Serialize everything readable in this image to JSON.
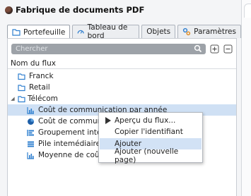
{
  "app": {
    "title": "Fabrique de documents PDF"
  },
  "tabs": [
    {
      "label": "Portefeuille",
      "active": true,
      "icon": "folder-icon"
    },
    {
      "label": "Tableau de bord",
      "active": false,
      "icon": "gauge-icon"
    },
    {
      "label": "Objets",
      "active": false,
      "icon": ""
    },
    {
      "label": "Paramètres",
      "active": false,
      "icon": "gears-icon"
    }
  ],
  "search": {
    "placeholder": "Chercher",
    "value": ""
  },
  "list": {
    "column_header": "Nom du flux",
    "items": [
      {
        "label": "Franck",
        "icon": "folder-icon",
        "indent": 1
      },
      {
        "label": "Retail",
        "icon": "folder-icon",
        "indent": 1
      },
      {
        "label": "Télécom",
        "icon": "folder-icon",
        "indent": 0,
        "expanded": true
      },
      {
        "label": "Coût de communication par année",
        "icon": "bar-chart-icon",
        "indent": 2,
        "selected": true
      },
      {
        "label": "Coût de communic",
        "icon": "pie-chart-icon",
        "indent": 2
      },
      {
        "label": "Groupement intelli",
        "icon": "grouping-icon",
        "indent": 2
      },
      {
        "label": "Pile intemédiaire",
        "icon": "stack-icon",
        "indent": 2
      },
      {
        "label": "Moyenne de coût a",
        "icon": "bar-chart-icon",
        "indent": 2
      }
    ]
  },
  "context_menu": {
    "items": [
      {
        "label": "Aperçu du flux...",
        "highlighted": false
      },
      {
        "label": "Copier l'identifiant",
        "highlighted": false
      },
      {
        "label": "Ajouter",
        "highlighted": true
      },
      {
        "label": "Ajouter (nouvelle page)",
        "highlighted": false
      }
    ]
  },
  "colors": {
    "selection": "#cfe0f4",
    "menu_highlight": "#d2e2f5",
    "icon_blue": "#2f7fcf",
    "search_bg": "#9da2a8"
  }
}
